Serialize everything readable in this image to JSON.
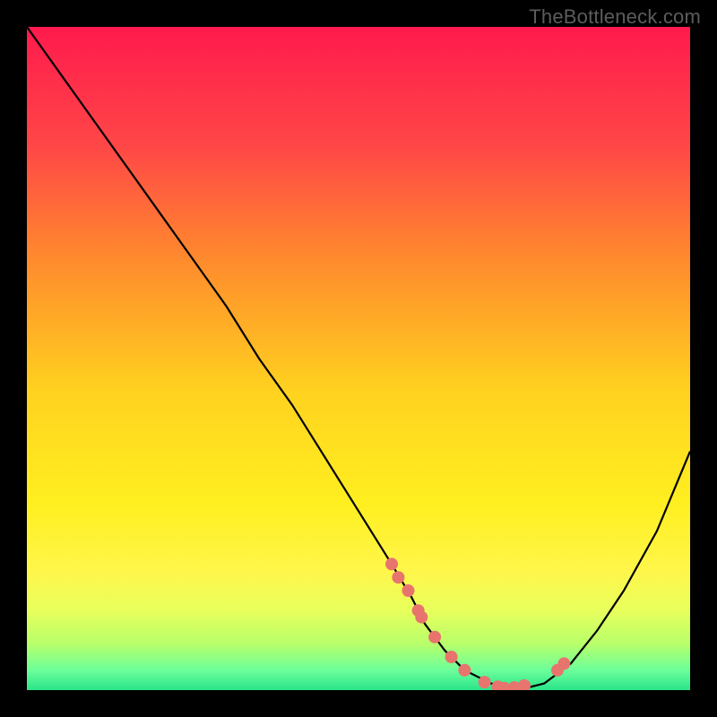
{
  "watermark": "TheBottleneck.com",
  "chart_data": {
    "type": "line",
    "title": "",
    "xlabel": "",
    "ylabel": "",
    "xlim": [
      0,
      100
    ],
    "ylim": [
      0,
      100
    ],
    "curve": {
      "name": "bottleneck-curve",
      "x": [
        0,
        5,
        10,
        15,
        20,
        25,
        30,
        35,
        40,
        45,
        50,
        55,
        58,
        60,
        63,
        66,
        70,
        74,
        78,
        82,
        86,
        90,
        95,
        100
      ],
      "y": [
        100,
        93,
        86,
        79,
        72,
        65,
        58,
        50,
        43,
        35,
        27,
        19,
        14,
        10,
        6,
        3,
        1,
        0,
        1,
        4,
        9,
        15,
        24,
        36
      ]
    },
    "points": {
      "name": "sample-markers",
      "color": "#e8746e",
      "x": [
        55,
        56,
        57.5,
        59,
        59.5,
        61.5,
        64,
        66,
        69,
        71,
        72,
        73.5,
        75,
        80,
        81
      ],
      "y": [
        19,
        17,
        15,
        12,
        11,
        8,
        5,
        3,
        1.2,
        0.5,
        0.3,
        0.4,
        0.7,
        3,
        4
      ]
    },
    "background": {
      "type": "vertical-gradient",
      "stops": [
        {
          "pos": 0.0,
          "color": "#ff1a4d"
        },
        {
          "pos": 0.18,
          "color": "#ff4747"
        },
        {
          "pos": 0.35,
          "color": "#ff8a2d"
        },
        {
          "pos": 0.55,
          "color": "#ffd21f"
        },
        {
          "pos": 0.72,
          "color": "#ffef20"
        },
        {
          "pos": 0.82,
          "color": "#fff64a"
        },
        {
          "pos": 0.88,
          "color": "#e8ff5c"
        },
        {
          "pos": 0.93,
          "color": "#b8ff6a"
        },
        {
          "pos": 0.97,
          "color": "#6cff9a"
        },
        {
          "pos": 1.0,
          "color": "#29e48a"
        }
      ]
    }
  }
}
